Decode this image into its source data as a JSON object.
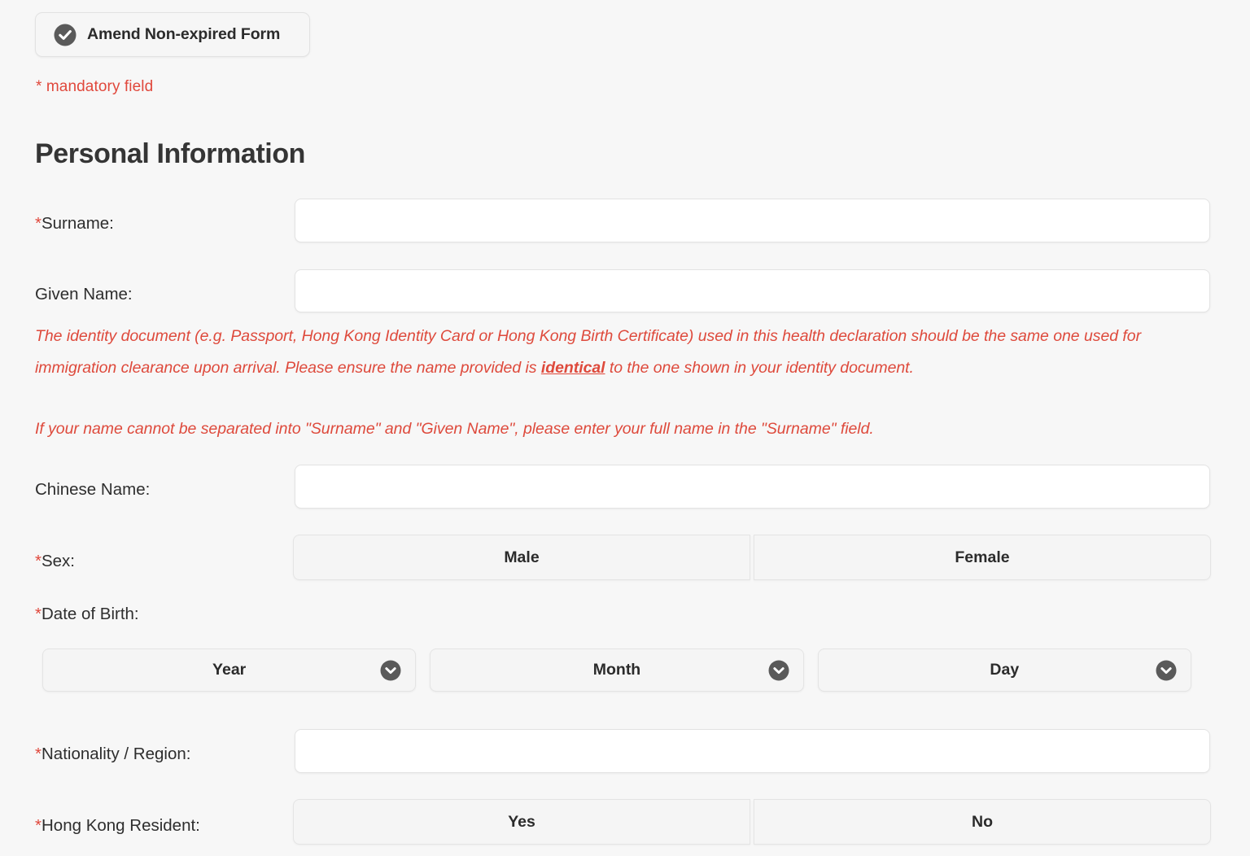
{
  "colors": {
    "page_background": "#f7f7f7",
    "accent_red": "#e0483c",
    "notice_red": "#de4a3c",
    "icon_gray": "#5a5a5a",
    "text_dark": "#2e2e2e"
  },
  "amend_button": {
    "label": "Amend Non-expired Form",
    "icon": "check-circle-icon"
  },
  "mandatory_note": "* mandatory field",
  "section": {
    "title": "Personal Information"
  },
  "fields": {
    "surname": {
      "required_mark": "*",
      "label": "Surname:",
      "value": "",
      "placeholder": ""
    },
    "given_name": {
      "required_mark": "",
      "label": "Given Name:",
      "value": "",
      "placeholder": ""
    },
    "chinese_name": {
      "required_mark": "",
      "label": "Chinese Name:",
      "value": "",
      "placeholder": ""
    },
    "sex": {
      "required_mark": "*",
      "label": "Sex:",
      "options": [
        "Male",
        "Female"
      ],
      "selected": ""
    },
    "date_of_birth": {
      "required_mark": "*",
      "label": "Date of Birth:",
      "selects": [
        {
          "name": "year",
          "value": "Year"
        },
        {
          "name": "month",
          "value": "Month"
        },
        {
          "name": "day",
          "value": "Day"
        }
      ]
    },
    "nationality": {
      "required_mark": "*",
      "label": "Nationality / Region:",
      "value": "",
      "placeholder": ""
    },
    "hong_kong_resident": {
      "required_mark": "*",
      "label": "Hong Kong Resident:",
      "options": [
        "Yes",
        "No"
      ],
      "selected": ""
    }
  },
  "notices": {
    "identity_document": {
      "part1": "The identity document (e.g. Passport, Hong Kong Identity Card or Hong Kong Birth Certificate) used in this health declaration should be the same one used for immigration clearance upon arrival. Please ensure the name provided is ",
      "emphasis": "identical",
      "part2": " to the one shown in your identity document."
    },
    "name_separation": "If your name cannot be separated into \"Surname\" and \"Given Name\", please enter your full name in the \"Surname\" field."
  }
}
